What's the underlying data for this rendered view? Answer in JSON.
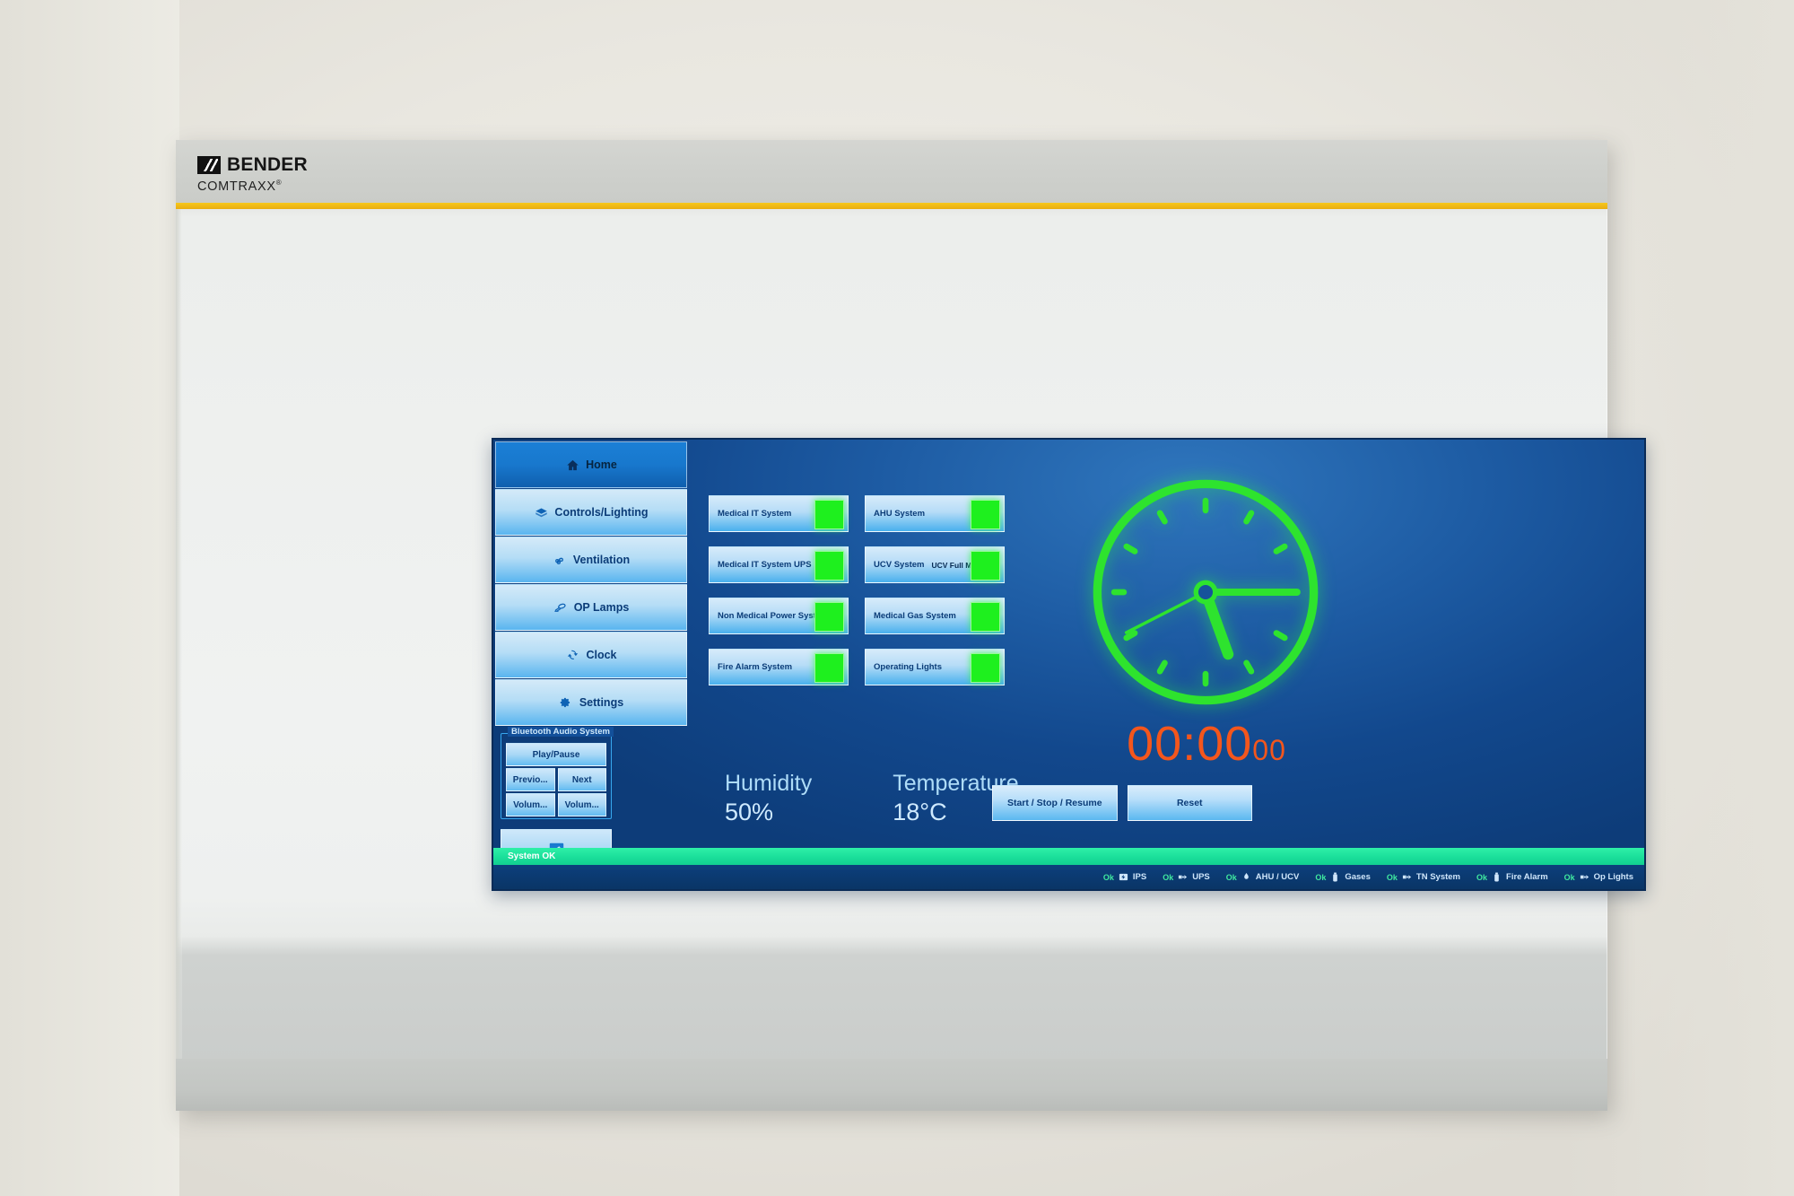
{
  "brand": {
    "name": "BENDER",
    "sub": "COMTRAXX",
    "sub_mark": "®",
    "accent_color": "#f2bb16"
  },
  "sidebar": {
    "items": [
      {
        "label": "Home",
        "icon": "home-icon",
        "active": true
      },
      {
        "label": "Controls/Lighting",
        "icon": "controls-lighting-icon",
        "active": false
      },
      {
        "label": "Ventilation",
        "icon": "ventilation-icon",
        "active": false
      },
      {
        "label": "OP Lamps",
        "icon": "op-lamps-icon",
        "active": false
      },
      {
        "label": "Clock",
        "icon": "clock-refresh-icon",
        "active": false
      },
      {
        "label": "Settings",
        "icon": "gear-icon",
        "active": false
      }
    ]
  },
  "bluetooth": {
    "legend": "Bluetooth Audio System",
    "play_pause": "Play/Pause",
    "previous": "Previo...",
    "next": "Next",
    "volume_down": "Volum...",
    "volume_up": "Volum...",
    "clean_icon": "touch-clean-icon"
  },
  "tiles": {
    "left": [
      {
        "label": "Medical IT System",
        "sub": "",
        "led": "green"
      },
      {
        "label": "Medical IT System UPS",
        "sub": "",
        "led": "green"
      },
      {
        "label": "Non Medical Power System",
        "sub": "",
        "led": "green"
      },
      {
        "label": "Fire Alarm System",
        "sub": "",
        "led": "green"
      }
    ],
    "right": [
      {
        "label": "AHU System",
        "sub": "",
        "led": "green"
      },
      {
        "label": "UCV System",
        "sub": "UCV Full Mode",
        "led": "green"
      },
      {
        "label": "Medical Gas System",
        "sub": "",
        "led": "green"
      },
      {
        "label": "Operating Lights",
        "sub": "",
        "led": "green"
      }
    ],
    "led_color": "#1ef01e"
  },
  "readouts": [
    {
      "title": "Humidity",
      "value": "50%"
    },
    {
      "title": "Temperature",
      "value": "18°C"
    }
  ],
  "clock": {
    "color": "#2ee32e",
    "hour_angle": 160,
    "minute_angle": 90,
    "second_angle": 243,
    "tick_count": 12
  },
  "timer": {
    "main": "00:00",
    "centiseconds": "00",
    "color": "#f4561c",
    "start_stop_resume": "Start / Stop / Resume",
    "reset": "Reset"
  },
  "system_bar": {
    "text": "System OK",
    "color": "#19dd99"
  },
  "status_row": {
    "items": [
      {
        "ok": "Ok",
        "name": "IPS",
        "icon": "ips-icon"
      },
      {
        "ok": "Ok",
        "name": "UPS",
        "icon": "ups-icon"
      },
      {
        "ok": "Ok",
        "name": "AHU / UCV",
        "icon": "ahu-ucv-icon"
      },
      {
        "ok": "Ok",
        "name": "Gases",
        "icon": "gas-cylinder-icon"
      },
      {
        "ok": "Ok",
        "name": "TN System",
        "icon": "tn-system-icon"
      },
      {
        "ok": "Ok",
        "name": "Fire Alarm",
        "icon": "fire-alarm-icon"
      },
      {
        "ok": "Ok",
        "name": "Op Lights",
        "icon": "op-lights-icon"
      }
    ]
  }
}
